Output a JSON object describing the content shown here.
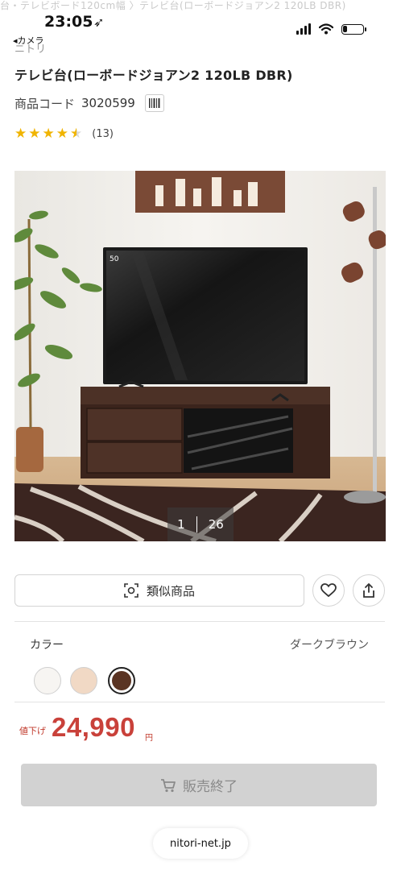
{
  "status": {
    "breadcrumb": "台・テレビボード120cm幅 〉テレビ台(ローボードジョアン2 120LB DBR)",
    "time": "23:05",
    "back_app": "◂カメラ",
    "battery_percent": 20
  },
  "product": {
    "brand_cut": "ニトリ",
    "title": "テレビ台(ローボードジョアン2 120LB DBR)",
    "code_label": "商品コード",
    "code_value": "3020599",
    "rating": 4.5,
    "review_count": "(13)"
  },
  "gallery": {
    "current": "1",
    "total": "26",
    "tv_badge": "50"
  },
  "actions": {
    "similar_label": "類似商品",
    "favorite_icon": "heart-icon",
    "share_icon": "share-icon"
  },
  "color": {
    "label": "カラー",
    "selected_name": "ダークブラウン",
    "swatches": [
      {
        "name": "white",
        "hex": "#f7f5f2"
      },
      {
        "name": "natural",
        "hex": "#f1d9c5"
      },
      {
        "name": "dark-brown",
        "hex": "#5a3423"
      }
    ]
  },
  "price": {
    "tag": "値下げ",
    "amount": "24,990",
    "unit": "円",
    "accent": "#c9413a"
  },
  "purchase": {
    "button_label": "販売終了",
    "cart_icon": "cart-icon"
  },
  "browser": {
    "domain": "nitori-net.jp"
  }
}
